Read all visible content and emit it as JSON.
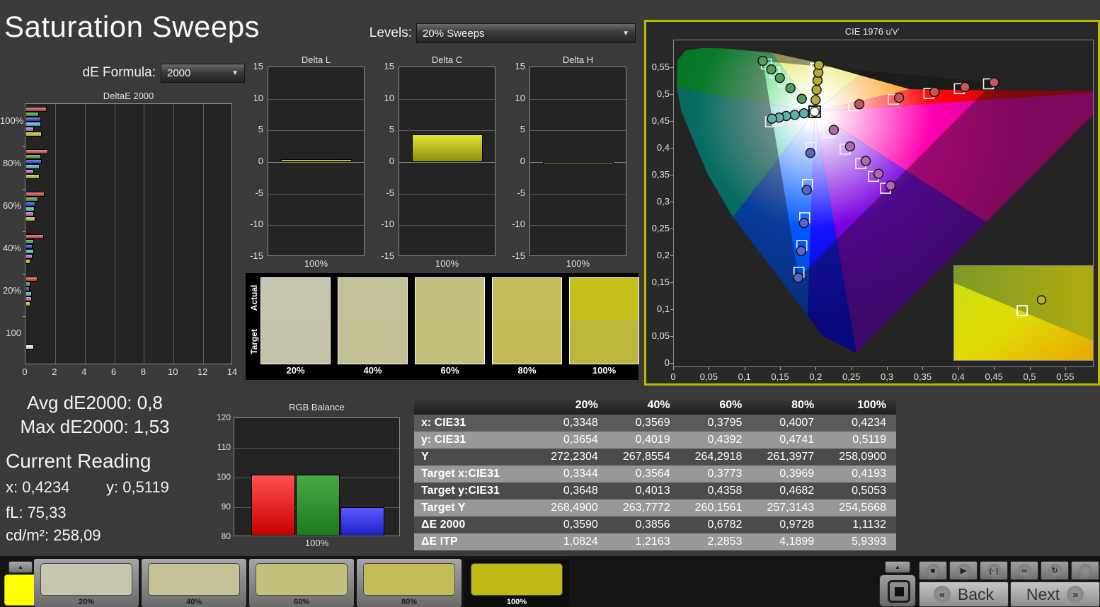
{
  "app": {
    "title": "Saturation Sweeps"
  },
  "controls": {
    "de_formula_label": "dE Formula:",
    "de_formula_value": "2000",
    "levels_label": "Levels:",
    "levels_value": "20% Sweeps",
    "caret": "▼"
  },
  "deltae_chart": {
    "type": "bar",
    "title": "DeltaE 2000",
    "x_ticks": [
      "0",
      "2",
      "4",
      "6",
      "8",
      "10",
      "12",
      "14"
    ],
    "xlim": [
      0,
      14
    ],
    "series_order": [
      "red",
      "green",
      "blue",
      "cyan",
      "magenta",
      "yellow"
    ],
    "series_colors": {
      "red": [
        "#e89090",
        "#b03030"
      ],
      "green": [
        "#7cc87c",
        "#2e8f2e"
      ],
      "blue": [
        "#8888e8",
        "#3030b0"
      ],
      "cyan": [
        "#8ed0d0",
        "#3f9f9f"
      ],
      "magenta": [
        "#e0a0e0",
        "#a050a0"
      ],
      "yellow": [
        "#d8d878",
        "#9f9f20"
      ],
      "white": [
        "#ffffff",
        "#c0c0c0"
      ]
    },
    "groups": [
      {
        "label": "100%",
        "values": [
          1.45,
          0.9,
          1.05,
          1.05,
          0.55,
          1.1
        ]
      },
      {
        "label": "80%",
        "values": [
          1.55,
          1.05,
          1.1,
          0.95,
          0.55,
          0.95
        ]
      },
      {
        "label": "60%",
        "values": [
          1.3,
          0.85,
          0.65,
          0.6,
          0.55,
          0.65
        ]
      },
      {
        "label": "40%",
        "values": [
          1.25,
          0.55,
          0.5,
          0.55,
          0.5,
          0.35
        ]
      },
      {
        "label": "20%",
        "values": [
          0.8,
          0.35,
          0.3,
          0.45,
          0.45,
          0.35
        ]
      },
      {
        "label": "100",
        "values": [
          0.55
        ],
        "single": true
      }
    ]
  },
  "delta_lch": {
    "type": "bar",
    "axis_ticks": [
      "15",
      "10",
      "5",
      "0",
      "-5",
      "-10",
      "-15"
    ],
    "ylim": [
      -15,
      15
    ],
    "xlabel": "100%",
    "charts": [
      {
        "title": "Delta L",
        "value": 0.4
      },
      {
        "title": "Delta C",
        "value": 4.4
      },
      {
        "title": "Delta H",
        "value": -0.35
      }
    ]
  },
  "sample_strip": {
    "row_labels": [
      "Actual",
      "Target"
    ],
    "items": [
      {
        "label": "20%",
        "actual": "#c6c5ad",
        "target": "#c4c3a9"
      },
      {
        "label": "40%",
        "actual": "#c5c299",
        "target": "#c4c095"
      },
      {
        "label": "60%",
        "actual": "#c4c180",
        "target": "#c2bf7a"
      },
      {
        "label": "80%",
        "actual": "#c3bd5b",
        "target": "#c1bb56"
      },
      {
        "label": "100%",
        "actual": "#c4c11d",
        "target": "#bab73c"
      }
    ]
  },
  "cie": {
    "type": "scatter",
    "title": "CIE 1976 u'v'",
    "x_ticks": [
      "0",
      "0,05",
      "0,1",
      "0,15",
      "0,2",
      "0,25",
      "0,3",
      "0,35",
      "0,4",
      "0,45",
      "0,5",
      "0,55"
    ],
    "y_ticks": [
      "0,55",
      "0,5",
      "0,45",
      "0,4",
      "0,35",
      "0,3",
      "0,25",
      "0,2",
      "0,15",
      "0,1",
      "0,05",
      "0"
    ],
    "border_color": "#bdb800",
    "white_point": {
      "u": 0.198,
      "v": 0.468
    },
    "locus": [
      [
        0.257,
        0.017
      ],
      [
        0.21,
        0.048
      ],
      [
        0.188,
        0.087
      ],
      [
        0.135,
        0.18
      ],
      [
        0.083,
        0.271
      ],
      [
        0.048,
        0.35
      ],
      [
        0.028,
        0.412
      ],
      [
        0.01,
        0.47
      ],
      [
        0.004,
        0.513
      ],
      [
        0.005,
        0.564
      ],
      [
        0.016,
        0.582
      ],
      [
        0.04,
        0.587
      ],
      [
        0.07,
        0.586
      ],
      [
        0.138,
        0.578
      ],
      [
        0.193,
        0.562
      ],
      [
        0.262,
        0.536
      ],
      [
        0.332,
        0.51
      ],
      [
        0.45,
        0.508
      ],
      [
        0.623,
        0.507
      ]
    ],
    "wedges": [
      {
        "hue": "#00b09a",
        "dark": "#007a6a",
        "from": 4,
        "to": 8
      },
      {
        "hue": "#00c83c",
        "dark": "#009a2e",
        "from": 8,
        "to": 13
      },
      {
        "hue": "#d8d800",
        "dark": "#b0b000",
        "from": 13,
        "to": 15
      },
      {
        "hue": "#ff9000",
        "dark": "#d87000",
        "from": 15,
        "to": 16
      },
      {
        "hue": "#ff0a0a",
        "dark": "#c80000",
        "from": 16,
        "to": 18
      },
      {
        "hue": "#ff00b0",
        "dark": "#cc0090",
        "pts": [
          [
            0.623,
            0.507
          ],
          [
            0.44,
            0.262
          ]
        ]
      },
      {
        "hue": "#7a00e0",
        "dark": "#5a00a8",
        "pts": [
          [
            0.44,
            0.262
          ],
          [
            0.257,
            0.017
          ]
        ]
      },
      {
        "hue": "#1414ff",
        "dark": "#0000c8",
        "from": 0,
        "to": 2
      },
      {
        "hue": "#0058ff",
        "dark": "#0040c0",
        "from": 2,
        "to": 4
      }
    ],
    "gamut_triangle": [
      [
        0.4507,
        0.5229
      ],
      [
        0.125,
        0.5625
      ],
      [
        0.1754,
        0.1579
      ]
    ],
    "series": [
      {
        "name": "red",
        "color": "#c45858",
        "points": [
          [
            0.261,
            0.482
          ],
          [
            0.317,
            0.494
          ],
          [
            0.367,
            0.505
          ],
          [
            0.41,
            0.514
          ],
          [
            0.451,
            0.523
          ]
        ],
        "targets": [
          [
            0.253,
            0.479
          ],
          [
            0.309,
            0.491
          ],
          [
            0.359,
            0.502
          ],
          [
            0.402,
            0.511
          ],
          [
            0.443,
            0.52
          ]
        ]
      },
      {
        "name": "green",
        "color": "#4f9f5a",
        "points": [
          [
            0.18,
            0.492
          ],
          [
            0.164,
            0.512
          ],
          [
            0.149,
            0.531
          ],
          [
            0.137,
            0.547
          ],
          [
            0.125,
            0.563
          ]
        ],
        "targets": [
          [
            0.185,
            0.486
          ],
          [
            0.169,
            0.506
          ],
          [
            0.154,
            0.525
          ],
          [
            0.142,
            0.541
          ],
          [
            0.13,
            0.557
          ]
        ]
      },
      {
        "name": "blue",
        "color": "#5a64c8",
        "points": [
          [
            0.192,
            0.391
          ],
          [
            0.187,
            0.322
          ],
          [
            0.183,
            0.26
          ],
          [
            0.179,
            0.208
          ],
          [
            0.175,
            0.158
          ]
        ],
        "targets": [
          [
            0.193,
            0.401
          ],
          [
            0.188,
            0.332
          ],
          [
            0.184,
            0.27
          ],
          [
            0.18,
            0.218
          ],
          [
            0.176,
            0.168
          ]
        ]
      },
      {
        "name": "cyan",
        "color": "#5fb0aa",
        "points": [
          [
            0.183,
            0.465
          ],
          [
            0.17,
            0.462
          ],
          [
            0.158,
            0.46
          ],
          [
            0.148,
            0.457
          ],
          [
            0.138,
            0.455
          ]
        ],
        "targets": [
          [
            0.181,
            0.459
          ],
          [
            0.168,
            0.456
          ],
          [
            0.156,
            0.454
          ],
          [
            0.146,
            0.451
          ],
          [
            0.136,
            0.449
          ]
        ]
      },
      {
        "name": "magenta",
        "color": "#b168b1",
        "points": [
          [
            0.225,
            0.434
          ],
          [
            0.248,
            0.403
          ],
          [
            0.27,
            0.376
          ],
          [
            0.288,
            0.352
          ],
          [
            0.305,
            0.33
          ]
        ],
        "targets": [
          [
            0.218,
            0.429
          ],
          [
            0.241,
            0.398
          ],
          [
            0.263,
            0.371
          ],
          [
            0.281,
            0.347
          ],
          [
            0.298,
            0.325
          ]
        ]
      },
      {
        "name": "yellow",
        "color": "#b4ad3a",
        "highlight": true,
        "points": [
          [
            0.1994,
            0.4897
          ],
          [
            0.2008,
            0.5088
          ],
          [
            0.2021,
            0.5262
          ],
          [
            0.2032,
            0.541
          ],
          [
            0.2041,
            0.5553
          ]
        ],
        "targets": [
          [
            0.1955,
            0.4855
          ],
          [
            0.1968,
            0.5046
          ],
          [
            0.198,
            0.5208
          ],
          [
            0.199,
            0.5347
          ],
          [
            0.2,
            0.549
          ]
        ]
      }
    ],
    "inset": {
      "circle": [
        0.63,
        0.36
      ],
      "square": [
        0.49,
        0.475
      ]
    }
  },
  "stats": {
    "avg": "Avg dE2000: 0,8",
    "max": "Max dE2000: 1,53",
    "heading": "Current Reading",
    "x": "x: 0,4234",
    "y": "y: 0,5119",
    "fl": "fL: 75,33",
    "cd": "cd/m²: 258,09"
  },
  "rgb_balance": {
    "type": "bar",
    "title": "RGB Balance",
    "y_ticks": [
      "120",
      "110",
      "100",
      "90",
      "80"
    ],
    "ylim": [
      80,
      120
    ],
    "xlabel": "100%",
    "categories": [
      "red",
      "green",
      "blue"
    ],
    "values": [
      100.5,
      100.5,
      89.5
    ],
    "colors": [
      [
        "#ff5050",
        "#c80000"
      ],
      [
        "#46aa46",
        "#1d7a1d"
      ],
      [
        "#5a5aff",
        "#2020cc"
      ]
    ]
  },
  "table": {
    "columns": [
      "",
      "20%",
      "40%",
      "60%",
      "80%",
      "100%"
    ],
    "rows": [
      {
        "label": "x: CIE31",
        "values": [
          "0,3348",
          "0,3569",
          "0,3795",
          "0,4007",
          "0,4234"
        ]
      },
      {
        "label": "y: CIE31",
        "values": [
          "0,3654",
          "0,4019",
          "0,4392",
          "0,4741",
          "0,5119"
        ]
      },
      {
        "label": "Y",
        "values": [
          "272,2304",
          "267,8554",
          "264,2918",
          "261,3977",
          "258,0900"
        ]
      },
      {
        "label": "Target x:CIE31",
        "values": [
          "0,3344",
          "0,3564",
          "0,3773",
          "0,3969",
          "0,4193"
        ]
      },
      {
        "label": "Target y:CIE31",
        "values": [
          "0,3648",
          "0,4013",
          "0,4358",
          "0,4682",
          "0,5053"
        ]
      },
      {
        "label": "Target Y",
        "values": [
          "268,4900",
          "263,7772",
          "260,1561",
          "257,3143",
          "254,5668"
        ]
      },
      {
        "label": "ΔE 2000",
        "values": [
          "0,3590",
          "0,3856",
          "0,6782",
          "0,9728",
          "1,1132"
        ]
      },
      {
        "label": "ΔE ITP",
        "values": [
          "1,0824",
          "1,2163",
          "2,2853",
          "4,1899",
          "5,9393"
        ]
      }
    ],
    "row_bg": [
      "#5a5a5a",
      "#989898",
      "#4b4b4b",
      "#989898",
      "#4b4b4b",
      "#989898",
      "#4b4b4b",
      "#989898"
    ]
  },
  "bottom_bar": {
    "current_color": "#ffff00",
    "tiles": [
      {
        "label": "20%",
        "color": "#c6c5ad",
        "selected": false
      },
      {
        "label": "40%",
        "color": "#c5c297",
        "selected": false
      },
      {
        "label": "60%",
        "color": "#c3c07c",
        "selected": false
      },
      {
        "label": "80%",
        "color": "#c2bc58",
        "selected": false
      },
      {
        "label": "100%",
        "color": "#bdba16",
        "selected": true
      }
    ]
  },
  "transport": {
    "back": "Back",
    "next": "Next",
    "back_chev": "«",
    "next_chev": "»",
    "up_arrow": "▲",
    "buttons": [
      {
        "name": "stop",
        "glyph": "■"
      },
      {
        "name": "play",
        "glyph": "▶"
      },
      {
        "name": "step",
        "glyph": "[··]"
      },
      {
        "name": "continuous",
        "glyph": "∞"
      },
      {
        "name": "refresh",
        "glyph": "↻"
      },
      {
        "name": "record",
        "glyph": ""
      }
    ]
  }
}
